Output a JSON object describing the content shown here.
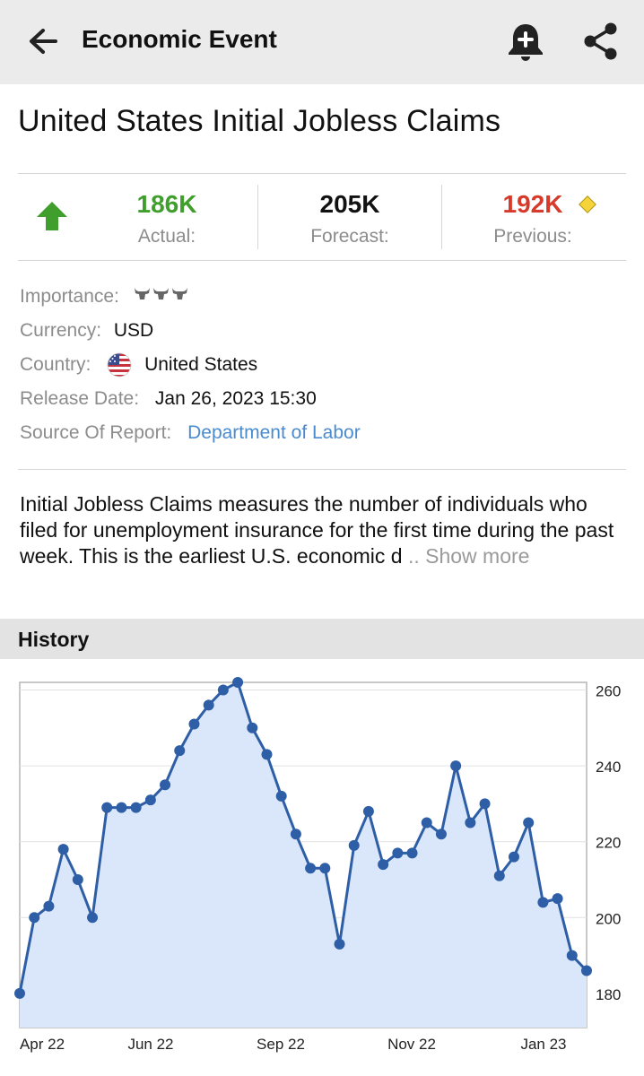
{
  "header": {
    "title": "Economic Event",
    "back_icon": "arrow-left-icon",
    "alert_icon": "bell-plus-icon",
    "share_icon": "share-icon"
  },
  "event": {
    "title": "United States Initial Jobless Claims",
    "trend_icon": "arrow-up-icon",
    "trend_color": "#3f9e2c",
    "actual": {
      "value": "186K",
      "label": "Actual:",
      "color": "#3f9e2c"
    },
    "forecast": {
      "value": "205K",
      "label": "Forecast:",
      "color": "#111111"
    },
    "previous": {
      "value": "192K",
      "label": "Previous:",
      "color": "#d63a2a",
      "badge_icon": "revised-diamond-icon"
    }
  },
  "details": {
    "importance_label": "Importance:",
    "importance_level": 3,
    "importance_icon": "bull-icon",
    "currency_label": "Currency:",
    "currency": "USD",
    "country_label": "Country:",
    "country_flag_icon": "us-flag-icon",
    "country": "United States",
    "release_label": "Release Date:",
    "release_date": "Jan 26, 2023 15:30",
    "source_label": "Source Of Report:",
    "source": "Department of Labor"
  },
  "description": {
    "text": "Initial Jobless Claims measures the number of individuals who filed for unemployment insurance for the first time during the past week. This is the earliest U.S. economic d",
    "more": ".. Show more"
  },
  "history": {
    "label": "History"
  },
  "chart_data": {
    "type": "area",
    "x_tick_labels": [
      "Apr 22",
      "Jun 22",
      "Sep 22",
      "Nov 22",
      "Jan 23"
    ],
    "y_tick_labels": [
      "260",
      "240",
      "220",
      "200",
      "180"
    ],
    "ylim": [
      171,
      262
    ],
    "grid": true,
    "line_color": "#2e5ea6",
    "fill_color": "#dae7fa",
    "series": [
      {
        "values": [
          180,
          200,
          203,
          218,
          210,
          200,
          229,
          229,
          229,
          231,
          235,
          244,
          251,
          256,
          260,
          262,
          250,
          243,
          232,
          222,
          213,
          213,
          193,
          219,
          228,
          214,
          217,
          217,
          225,
          222,
          240,
          225,
          230,
          211,
          216,
          225,
          204,
          205,
          190,
          186
        ]
      }
    ]
  }
}
